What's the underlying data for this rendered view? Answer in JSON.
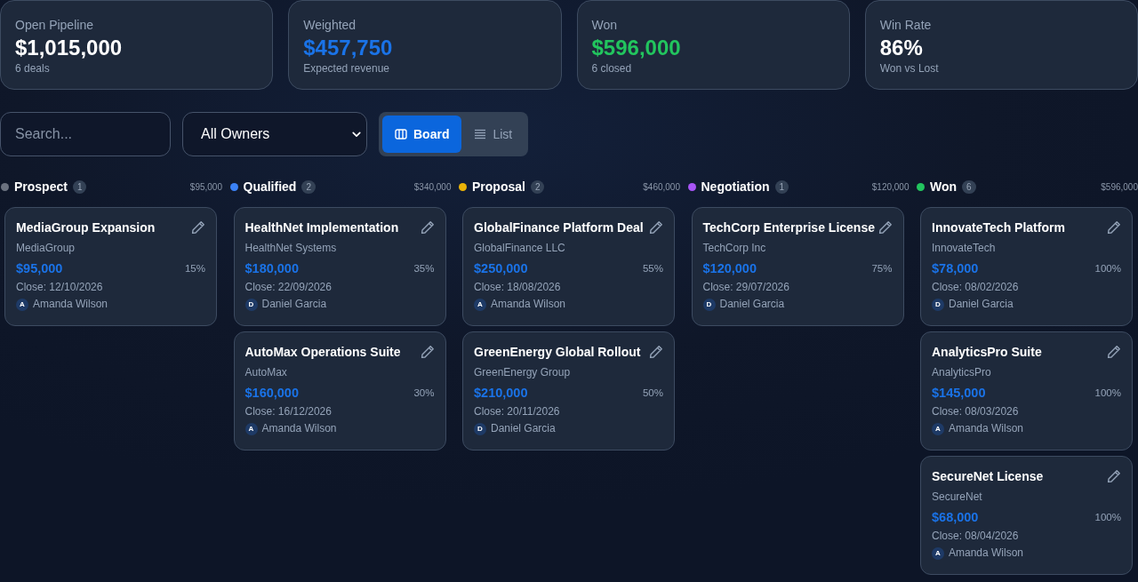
{
  "stats": [
    {
      "label": "Open Pipeline",
      "value": "$1,015,000",
      "sub": "6 deals",
      "color": "#ffffff"
    },
    {
      "label": "Weighted",
      "value": "$457,750",
      "sub": "Expected revenue",
      "color": "#1a73e8"
    },
    {
      "label": "Won",
      "value": "$596,000",
      "sub": "6 closed",
      "color": "#22c55e"
    },
    {
      "label": "Win Rate",
      "value": "86%",
      "sub": "Won vs Lost",
      "color": "#ffffff"
    }
  ],
  "toolbar": {
    "search": {
      "placeholder": "Search..."
    },
    "owner_filter": {
      "value": "All Owners"
    },
    "views": [
      {
        "label": "Board",
        "kind": "board",
        "selected": true
      },
      {
        "label": "List",
        "kind": "list",
        "selected": false
      }
    ]
  },
  "columns": [
    {
      "name": "Prospect",
      "count": "1",
      "total": "$95,000",
      "color": "#6b7280",
      "deals": [
        {
          "title": "MediaGroup Expansion",
          "company": "MediaGroup",
          "amount": "$95,000",
          "probability": "15%",
          "close": "Close: 12/10/2026",
          "owner_initial": "A",
          "owner": "Amanda Wilson"
        }
      ]
    },
    {
      "name": "Qualified",
      "count": "2",
      "total": "$340,000",
      "color": "#3b82f6",
      "deals": [
        {
          "title": "HealthNet Implementation",
          "company": "HealthNet Systems",
          "amount": "$180,000",
          "probability": "35%",
          "close": "Close: 22/09/2026",
          "owner_initial": "D",
          "owner": "Daniel Garcia"
        },
        {
          "title": "AutoMax Operations Suite",
          "company": "AutoMax",
          "amount": "$160,000",
          "probability": "30%",
          "close": "Close: 16/12/2026",
          "owner_initial": "A",
          "owner": "Amanda Wilson"
        }
      ]
    },
    {
      "name": "Proposal",
      "count": "2",
      "total": "$460,000",
      "color": "#eab308",
      "deals": [
        {
          "title": "GlobalFinance Platform Deal",
          "company": "GlobalFinance LLC",
          "amount": "$250,000",
          "probability": "55%",
          "close": "Close: 18/08/2026",
          "owner_initial": "A",
          "owner": "Amanda Wilson"
        },
        {
          "title": "GreenEnergy Global Rollout",
          "company": "GreenEnergy Group",
          "amount": "$210,000",
          "probability": "50%",
          "close": "Close: 20/11/2026",
          "owner_initial": "D",
          "owner": "Daniel Garcia"
        }
      ]
    },
    {
      "name": "Negotiation",
      "count": "1",
      "total": "$120,000",
      "color": "#a855f7",
      "deals": [
        {
          "title": "TechCorp Enterprise License",
          "company": "TechCorp Inc",
          "amount": "$120,000",
          "probability": "75%",
          "close": "Close: 29/07/2026",
          "owner_initial": "D",
          "owner": "Daniel Garcia"
        }
      ]
    },
    {
      "name": "Won",
      "count": "6",
      "total": "$596,000",
      "color": "#22c55e",
      "deals": [
        {
          "title": "InnovateTech Platform",
          "company": "InnovateTech",
          "amount": "$78,000",
          "probability": "100%",
          "close": "Close: 08/02/2026",
          "owner_initial": "D",
          "owner": "Daniel Garcia"
        },
        {
          "title": "AnalyticsPro Suite",
          "company": "AnalyticsPro",
          "amount": "$145,000",
          "probability": "100%",
          "close": "Close: 08/03/2026",
          "owner_initial": "A",
          "owner": "Amanda Wilson"
        },
        {
          "title": "SecureNet License",
          "company": "SecureNet",
          "amount": "$68,000",
          "probability": "100%",
          "close": "Close: 08/04/2026",
          "owner_initial": "A",
          "owner": "Amanda Wilson"
        }
      ]
    }
  ]
}
